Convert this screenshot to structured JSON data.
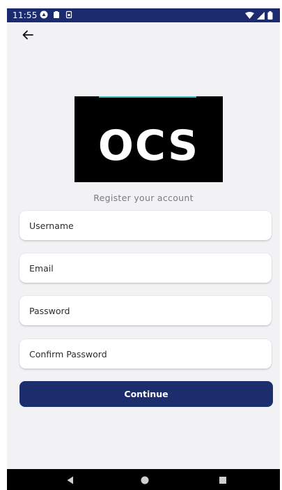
{
  "status_bar": {
    "time": "11:55",
    "left_icons": [
      "app-notification-icon",
      "lock-icon",
      "sim-icon"
    ],
    "right_icons": [
      "wifi-icon",
      "signal-icon",
      "battery-icon"
    ],
    "color": "#1c2a6e"
  },
  "header": {
    "back_icon": "arrow-left-icon"
  },
  "logo": {
    "text": "OCS",
    "background": "#000000",
    "accent": "#3bb4b8"
  },
  "form": {
    "subtitle": "Register your account",
    "fields": [
      {
        "name": "username",
        "placeholder": "Username",
        "value": ""
      },
      {
        "name": "email",
        "placeholder": "Email",
        "value": ""
      },
      {
        "name": "password",
        "placeholder": "Password",
        "value": ""
      },
      {
        "name": "confirm_password",
        "placeholder": "Confirm Password",
        "value": ""
      }
    ],
    "submit_label": "Continue",
    "submit_color": "#1c2d6e"
  },
  "nav_bar": {
    "buttons": [
      "back-triangle-icon",
      "home-circle-icon",
      "recents-square-icon"
    ]
  }
}
